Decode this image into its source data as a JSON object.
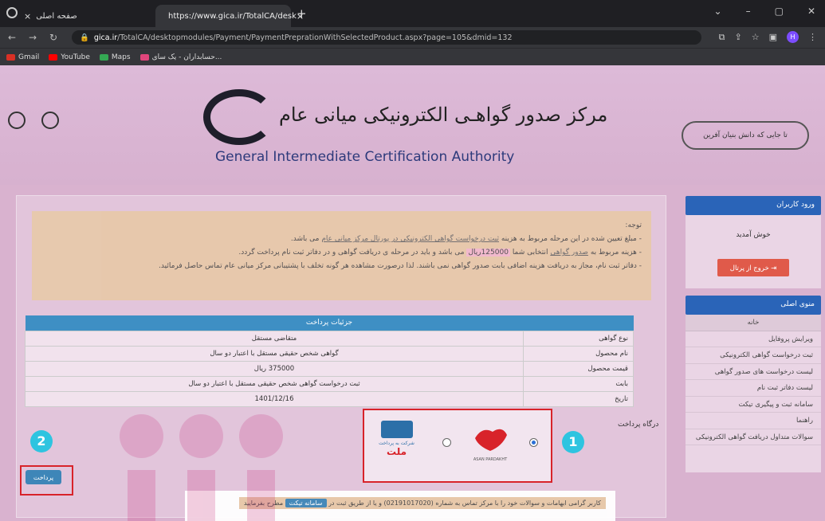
{
  "browser": {
    "inactive_tab": "صفحه اصلی",
    "active_tab": "https://www.gica.ir/TotalCA/desk",
    "url_host": "gica.ir",
    "url_path": "/TotalCA/desktopmodules/Payment/PaymentPreprationWithSelectedProduct.aspx?page=105&dmid=132",
    "avatar_letter": "H",
    "bookmarks": [
      "Gmail",
      "YouTube",
      "Maps",
      "حسابداران - یک سای..."
    ]
  },
  "header": {
    "title_fa": "مرکز صدور گواهـی الکترونیکی میانی عام",
    "title_en": "General Intermediate Certification Authority",
    "logo_right_text": "تا جایی که دانش بنیان آفرین"
  },
  "notice": {
    "title": "توجه:",
    "line1_a": "- مبلغ تعیین شده در این مرحله مربوط به هزینه",
    "line1_link": "ثبت درخواست گواهی الکترونیکی در پورتال مرکز میانی عام",
    "line1_b": "می باشد.",
    "line2_a": "- هزینه مربوط به",
    "line2_link": "صدور گواهی",
    "line2_b": "انتخابی شما",
    "line2_amount": "125000ریال",
    "line2_c": "می باشد و باید در مرحله ی دریافت گواهی و در دفاتر ثبت نام پرداخت گردد.",
    "line3": "- دفاتر ثبت نام، مجاز به دریافت هزینه اضافی بابت صدور گواهی نمی باشند. لذا درصورت مشاهده هر گونه تخلف با پشتیبانی مرکز میانی عام تماس حاصل فرمائید."
  },
  "payment_table": {
    "header": "جزئیات پرداخت",
    "rows": [
      {
        "label": "نوع گواهی",
        "value": "متقاضی مستقل"
      },
      {
        "label": "نام محصول",
        "value": "گواهی شخص حقیقی مستقل با اعتبار دو سال"
      },
      {
        "label": "قیمت محصول",
        "value": "375000 ریال"
      },
      {
        "label": "بابت",
        "value": "ثبت درخواست گواهی شخص حقیقی مستقل با اعتبار دو سال"
      },
      {
        "label": "تاریخ",
        "value": "1401/12/16"
      }
    ]
  },
  "gateway": {
    "label": "درگاه پرداخت",
    "mellat_line1": "شرکت به پرداخت",
    "mellat_line2": "ملت",
    "asan_caption": "ASAN PARDAKHT"
  },
  "badges": {
    "one": "1",
    "two": "2"
  },
  "pay_button": "پرداخت",
  "footer": {
    "text_a": "کاربر گرامی ابهامات و سوالات خود را با مرکز تماس به شماره (02191017020) و یا از طریق ثبت در",
    "button": "سامانه تیکت",
    "text_b": "مطرح بفرمایید"
  },
  "sidebar": {
    "login_head": "ورود کاربران",
    "welcome": "خوش آمدید",
    "logout": "خروج از پرتال",
    "menu_head": "منوی اصلی",
    "items": [
      "خانه",
      "ویرایش پروفایل",
      "ثبت درخواست گواهی الکترونیکی",
      "لیست درخواست های صدور گواهی",
      "لیست دفاتر ثبت نام",
      "سامانه ثبت و پیگیری تیکت",
      "راهنما",
      "سوالات متداول دریافت گواهی الکترونیکی"
    ]
  }
}
